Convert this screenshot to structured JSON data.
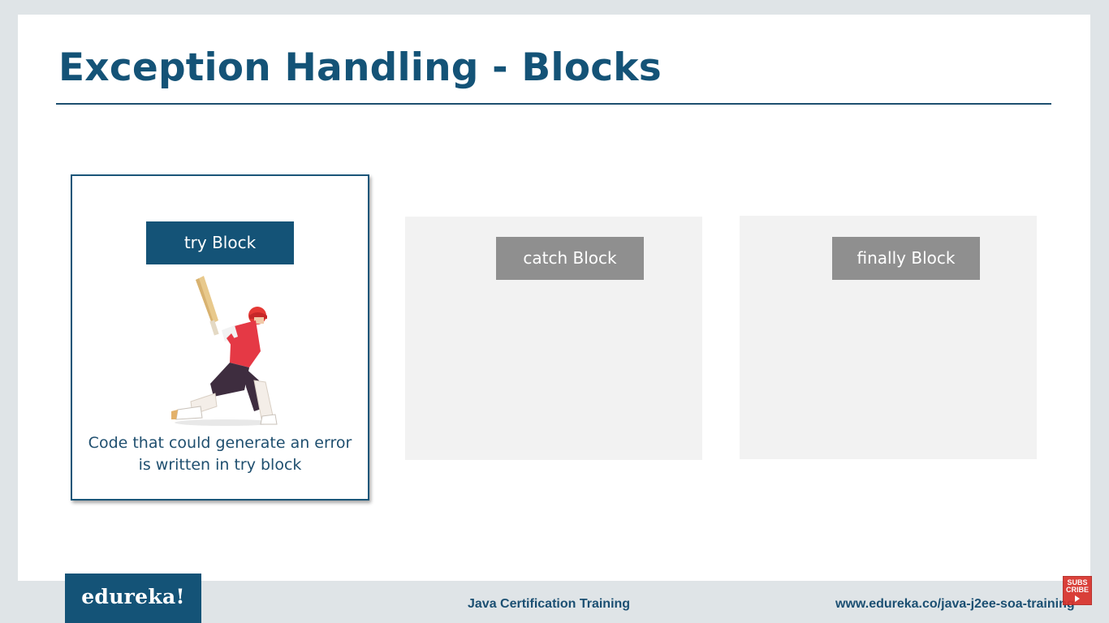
{
  "slide": {
    "title": "Exception Handling - Blocks"
  },
  "blocks": [
    {
      "label": "try Block",
      "description": "Code that could generate an error is written in try block",
      "state": "active",
      "image": "cricket-batsman-icon"
    },
    {
      "label": "catch Block",
      "state": "inactive"
    },
    {
      "label": "finally Block",
      "state": "inactive"
    }
  ],
  "footer": {
    "logo": "edureka!",
    "course": "Java Certification Training",
    "url": "www.edureka.co/java-j2ee-soa-training",
    "subscribe_label": "SUBS CRIBE"
  },
  "colors": {
    "brand_blue": "#145377",
    "inactive_label": "#8f8f8f",
    "inactive_card": "#f2f2f2",
    "subscribe_red": "#d9322b"
  }
}
